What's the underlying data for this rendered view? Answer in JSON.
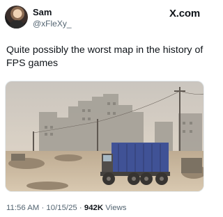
{
  "post": {
    "author_name": "Sam",
    "author_handle": "@xFleXy_",
    "brand": "X.com",
    "text": "Quite possibly the worst map in the history of FPS games",
    "time": "11:56 AM",
    "sep1": " · ",
    "date": "10/15/25",
    "sep2": " · ",
    "views_count": "942K",
    "views_label": " Views"
  },
  "icons": {
    "avatar": "profile-photo",
    "logo": "x-logo"
  },
  "colors": {
    "text": "#0f1419",
    "secondary": "#536471",
    "truck": "#2a3f8f"
  }
}
